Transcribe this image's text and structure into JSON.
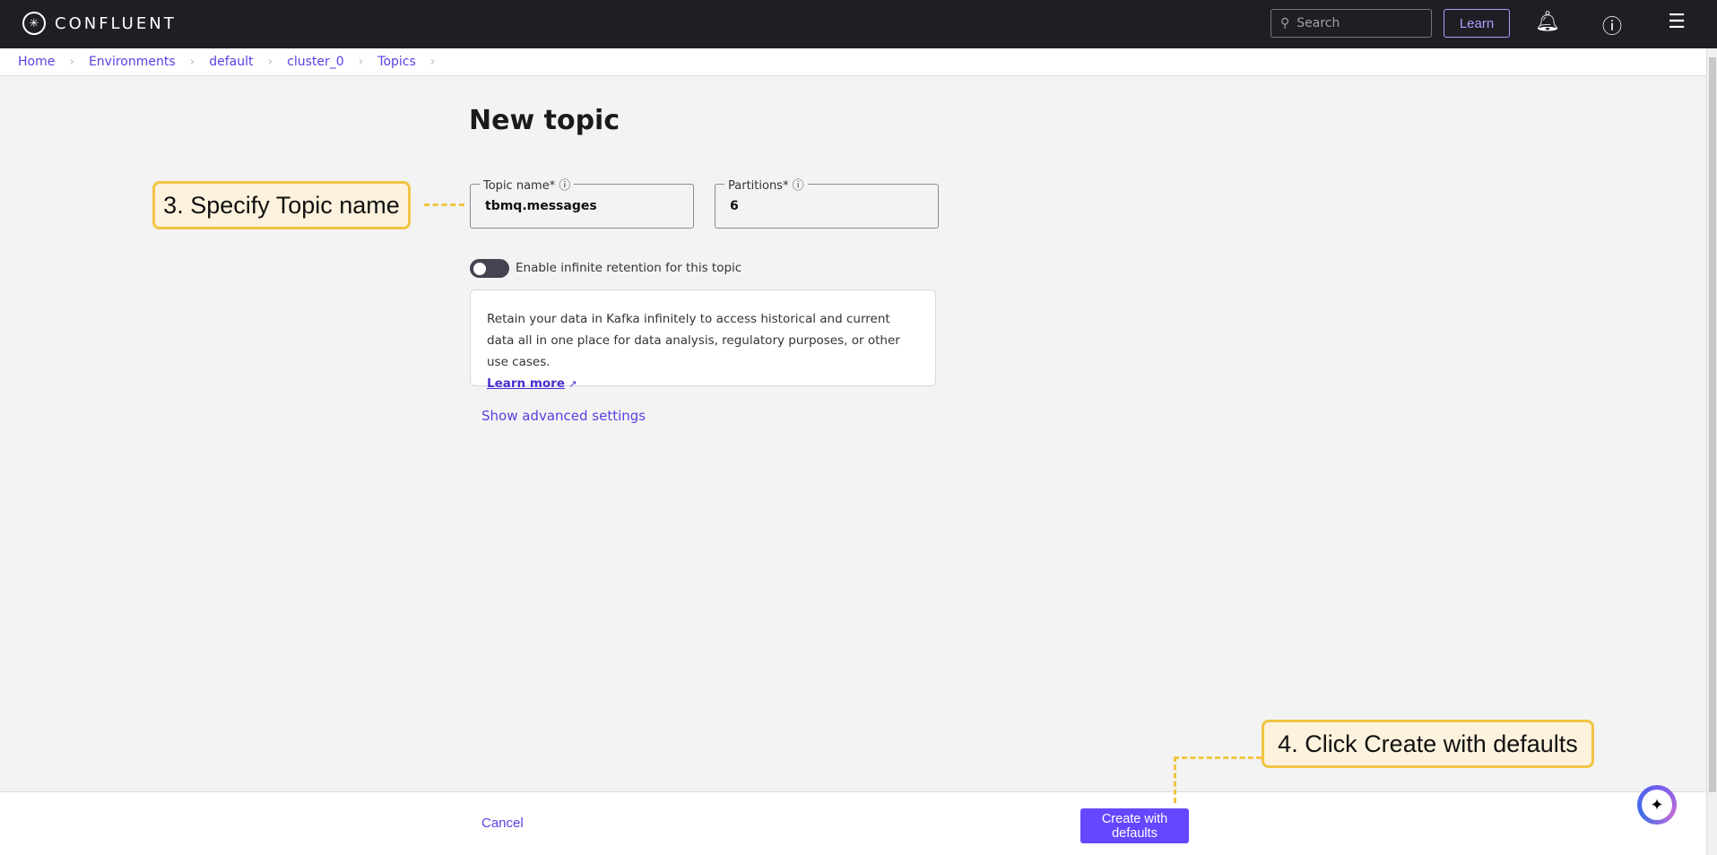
{
  "header": {
    "brand": "CONFLUENT",
    "search_placeholder": "Search",
    "learn_label": "Learn"
  },
  "breadcrumbs": [
    "Home",
    "Environments",
    "default",
    "cluster_0",
    "Topics"
  ],
  "page": {
    "title": "New topic",
    "topic_name": {
      "label": "Topic name*",
      "value": "tbmq.messages"
    },
    "partitions": {
      "label": "Partitions*",
      "value": "6"
    },
    "retention_toggle": {
      "label": "Enable infinite retention for this topic",
      "enabled": false
    },
    "info_text": "Retain your data in Kafka infinitely to access historical and current data all in one place for data analysis, regulatory purposes, or other use cases.",
    "learn_more": "Learn more",
    "advanced": "Show advanced settings"
  },
  "footer": {
    "cancel": "Cancel",
    "create": "Create with defaults"
  },
  "annotations": {
    "step3": "3. Specify Topic name",
    "step4": "4. Click Create with defaults"
  },
  "colors": {
    "accent": "#6448ff",
    "header": "#1f1e24",
    "callout": "#f1c444"
  }
}
